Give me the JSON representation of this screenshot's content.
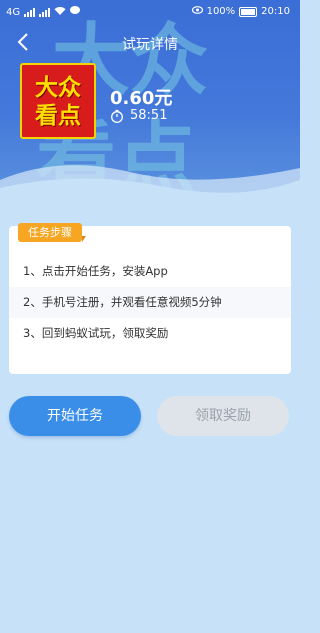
{
  "status_bar": {
    "network_left": "4G",
    "battery": "100%",
    "time": "20:10"
  },
  "navbar": {
    "title": "试玩详情",
    "back_icon": "chevron-left-icon"
  },
  "app": {
    "logo_line1": "大众",
    "logo_line2": "看点",
    "price": "0.60元",
    "countdown": "58:51",
    "timer_icon": "stopwatch-icon"
  },
  "task": {
    "tag": "任务步骤",
    "steps": [
      "1、点击开始任务，安装App",
      "2、手机号注册，并观看任意视频5分钟",
      "3、回到蚂蚁试玩，领取奖励"
    ]
  },
  "buttons": {
    "start": "开始任务",
    "claim": "领取奖励"
  },
  "colors": {
    "header": "#4478da",
    "page_bg": "#c7e1f8",
    "accent": "#3a8ee8",
    "tag": "#f6a623",
    "logo_bg": "#d81c1c",
    "logo_text": "#ffe000"
  }
}
